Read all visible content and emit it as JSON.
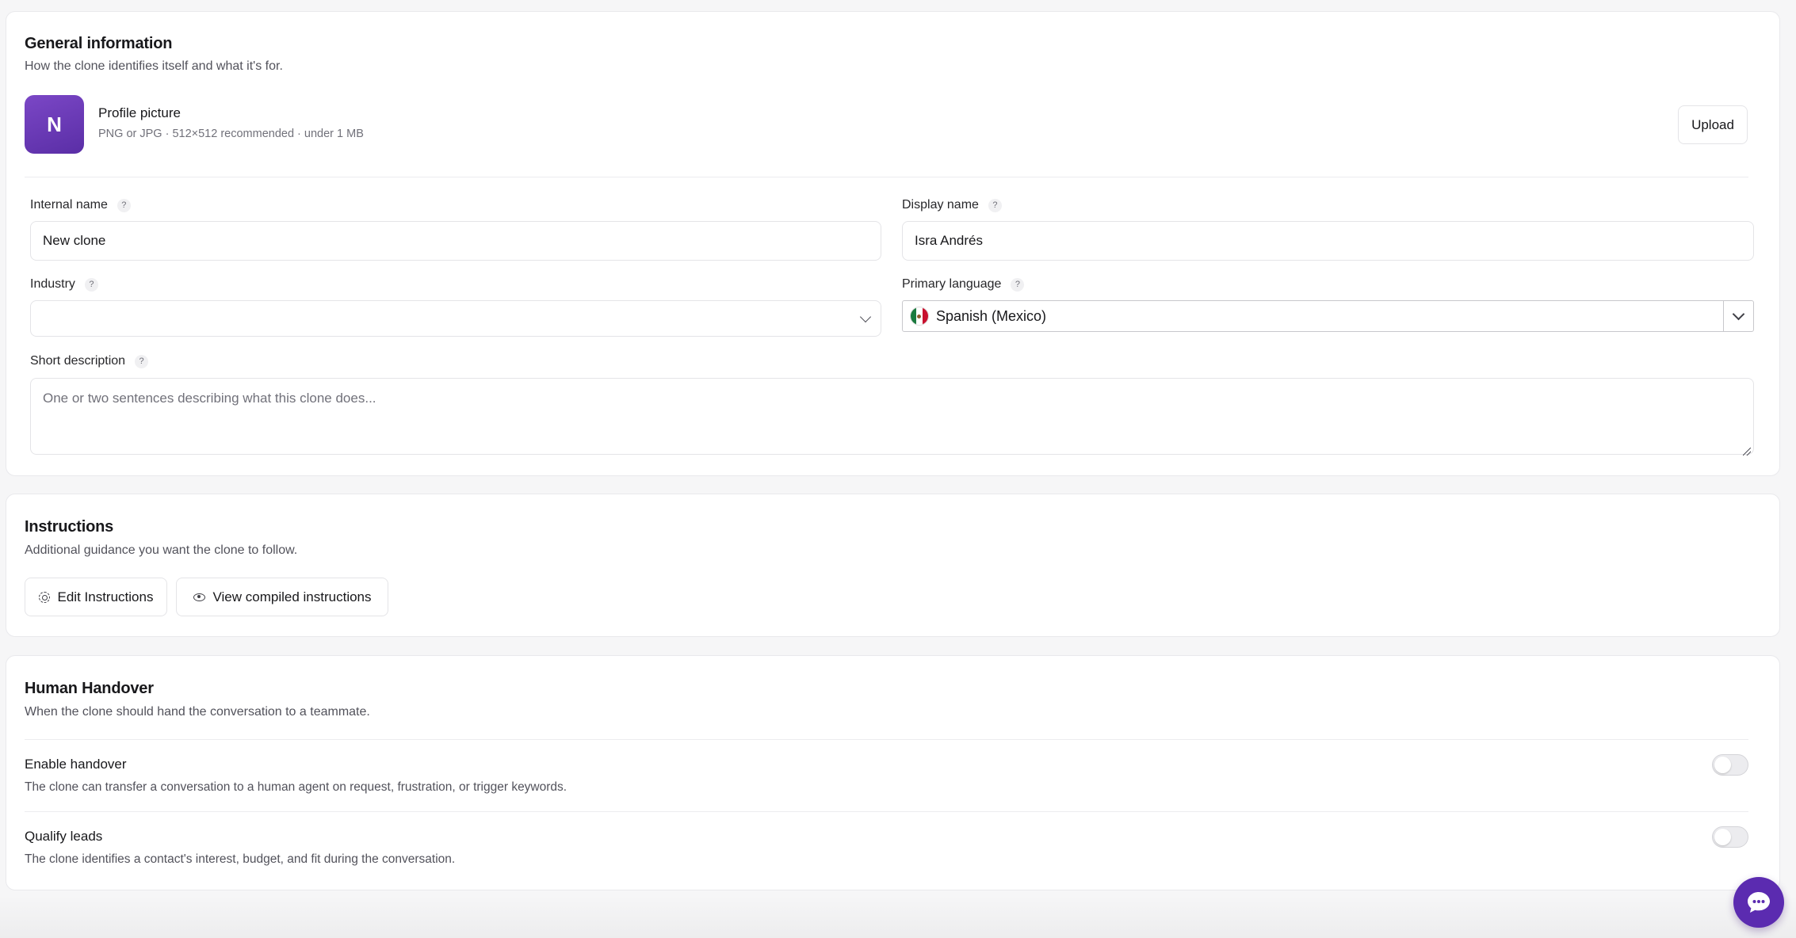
{
  "general": {
    "title": "General information",
    "subtitle": "How the clone identifies itself and what it's for.",
    "profile": {
      "avatar_letter": "N",
      "title": "Profile picture",
      "hint": "PNG or JPG · 512×512 recommended · under 1 MB",
      "upload_label": "Upload"
    },
    "internal_name": {
      "label": "Internal name",
      "value": "New clone"
    },
    "display_name": {
      "label": "Display name",
      "value": "Isra Andrés"
    },
    "industry": {
      "label": "Industry",
      "value": ""
    },
    "primary_language": {
      "label": "Primary language",
      "value": "Spanish (Mexico)",
      "flag": "mexico-flag-icon"
    },
    "short_description": {
      "label": "Short description",
      "placeholder": "One or two sentences describing what this clone does..."
    },
    "help_glyph": "?"
  },
  "instructions": {
    "title": "Instructions",
    "subtitle": "Additional guidance you want the clone to follow.",
    "edit_label": "Edit Instructions",
    "view_label": "View compiled instructions"
  },
  "handover": {
    "title": "Human Handover",
    "subtitle": "When the clone should hand the conversation to a teammate.",
    "enable": {
      "title": "Enable handover",
      "description": "The clone can transfer a conversation to a human agent on request, frustration, or trigger keywords.",
      "enabled": false
    },
    "qualify": {
      "title": "Qualify leads",
      "description": "The clone identifies a contact's interest, budget, and fit during the conversation.",
      "enabled": false
    }
  },
  "colors": {
    "accent": "#5b2bb0",
    "avatar": "#6b3bbd",
    "background": "#f6f6f7"
  }
}
